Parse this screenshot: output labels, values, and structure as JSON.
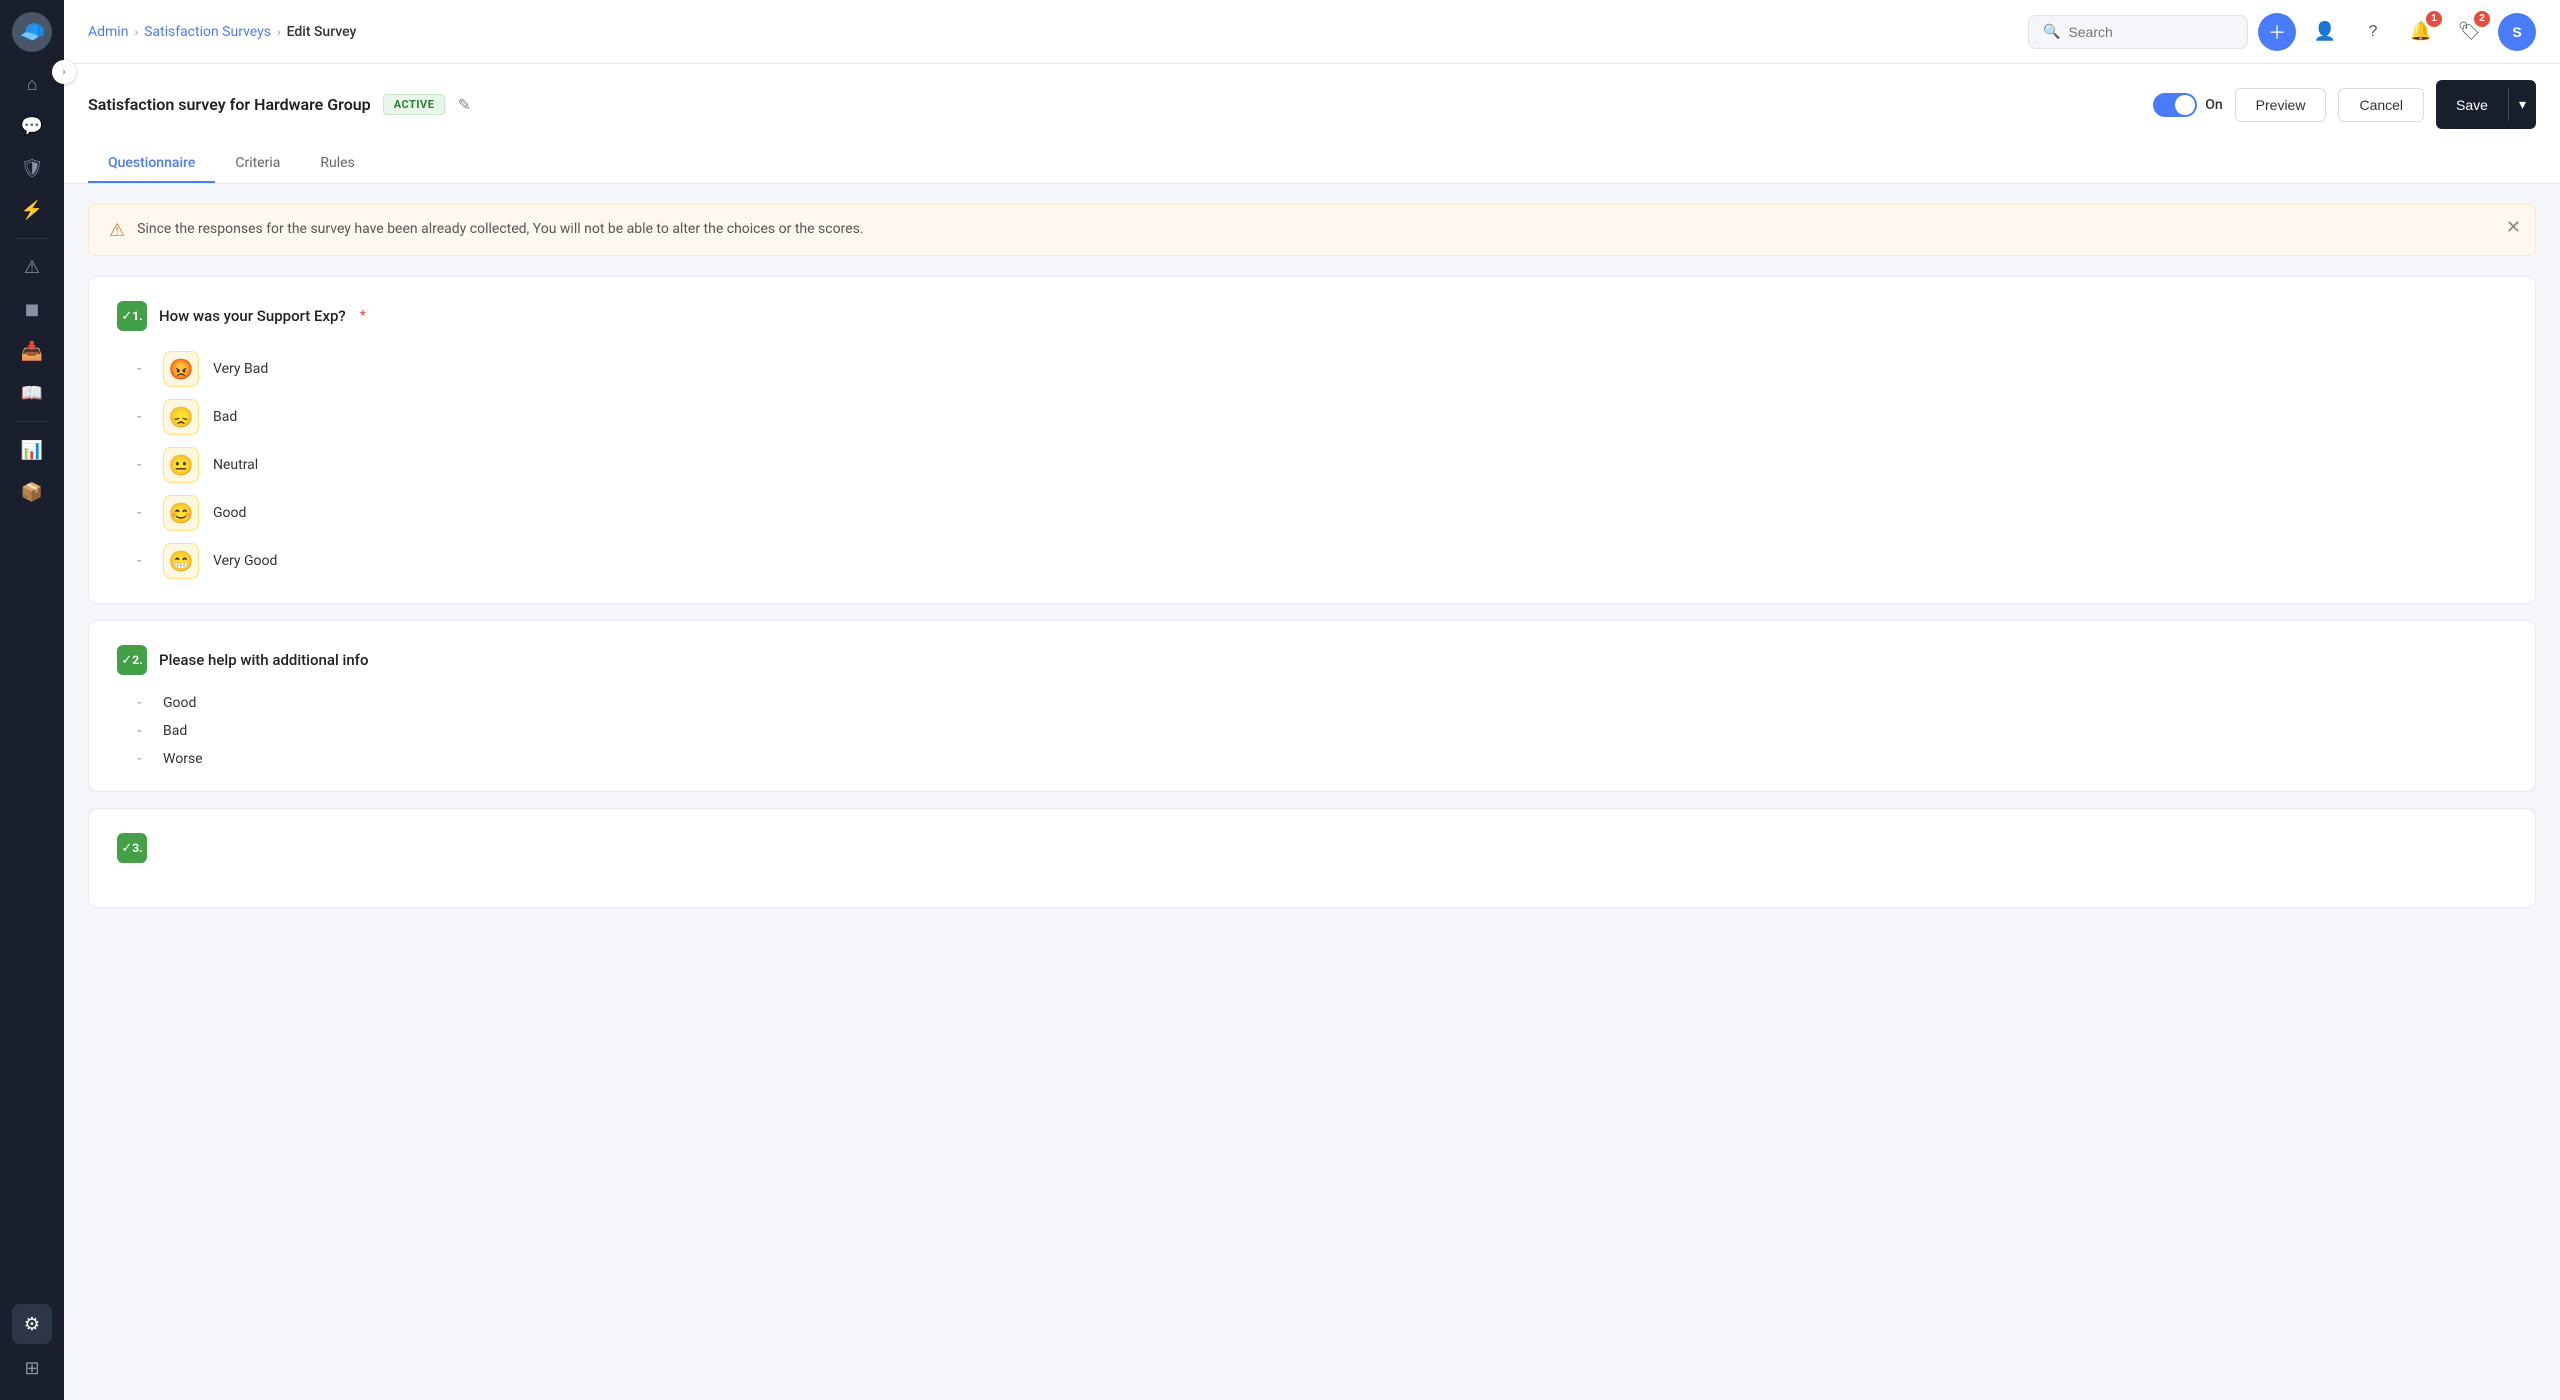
{
  "sidebar": {
    "icons": [
      {
        "name": "home-icon",
        "symbol": "⌂",
        "active": false
      },
      {
        "name": "chat-icon",
        "symbol": "💬",
        "active": false
      },
      {
        "name": "shield-icon",
        "symbol": "🛡",
        "active": false
      },
      {
        "name": "bolt-icon",
        "symbol": "⚡",
        "active": false
      },
      {
        "name": "warning-icon",
        "symbol": "⚠",
        "active": false
      },
      {
        "name": "layers-icon",
        "symbol": "◼",
        "active": false
      },
      {
        "name": "inbox-icon",
        "symbol": "📥",
        "active": false
      },
      {
        "name": "book-icon",
        "symbol": "📖",
        "active": false
      },
      {
        "name": "chart-icon",
        "symbol": "📊",
        "active": false
      },
      {
        "name": "box-icon",
        "symbol": "📦",
        "active": false
      },
      {
        "name": "settings-icon",
        "symbol": "⚙",
        "active": true
      },
      {
        "name": "grid-icon",
        "symbol": "⊞",
        "active": false
      }
    ]
  },
  "topnav": {
    "breadcrumb": {
      "admin": "Admin",
      "section": "Satisfaction Surveys",
      "current": "Edit Survey"
    },
    "search": {
      "placeholder": "Search"
    },
    "notifications": {
      "badge1": "1",
      "badge2": "2"
    },
    "user_initial": "S"
  },
  "survey": {
    "title": "Satisfaction survey for Hardware Group",
    "status_badge": "ACTIVE",
    "toggle_label": "On",
    "btn_preview": "Preview",
    "btn_cancel": "Cancel",
    "btn_save": "Save"
  },
  "tabs": [
    {
      "label": "Questionnaire",
      "active": true
    },
    {
      "label": "Criteria",
      "active": false
    },
    {
      "label": "Rules",
      "active": false
    }
  ],
  "alert": {
    "text": "Since the responses for the survey have been already collected, You will not be able to alter the choices or the scores."
  },
  "questions": [
    {
      "number": "1.",
      "text": "How was your Support Exp?",
      "required": true,
      "type": "emoji",
      "answers": [
        {
          "label": "Very Bad",
          "emoji": "😡"
        },
        {
          "label": "Bad",
          "emoji": "😞"
        },
        {
          "label": "Neutral",
          "emoji": "😐"
        },
        {
          "label": "Good",
          "emoji": "😊"
        },
        {
          "label": "Very Good",
          "emoji": "😁"
        }
      ]
    },
    {
      "number": "2.",
      "text": "Please help with additional info",
      "required": false,
      "type": "simple",
      "answers": [
        {
          "label": "Good"
        },
        {
          "label": "Bad"
        },
        {
          "label": "Worse"
        }
      ]
    },
    {
      "number": "3.",
      "text": "",
      "required": false,
      "type": "partial",
      "answers": []
    }
  ]
}
